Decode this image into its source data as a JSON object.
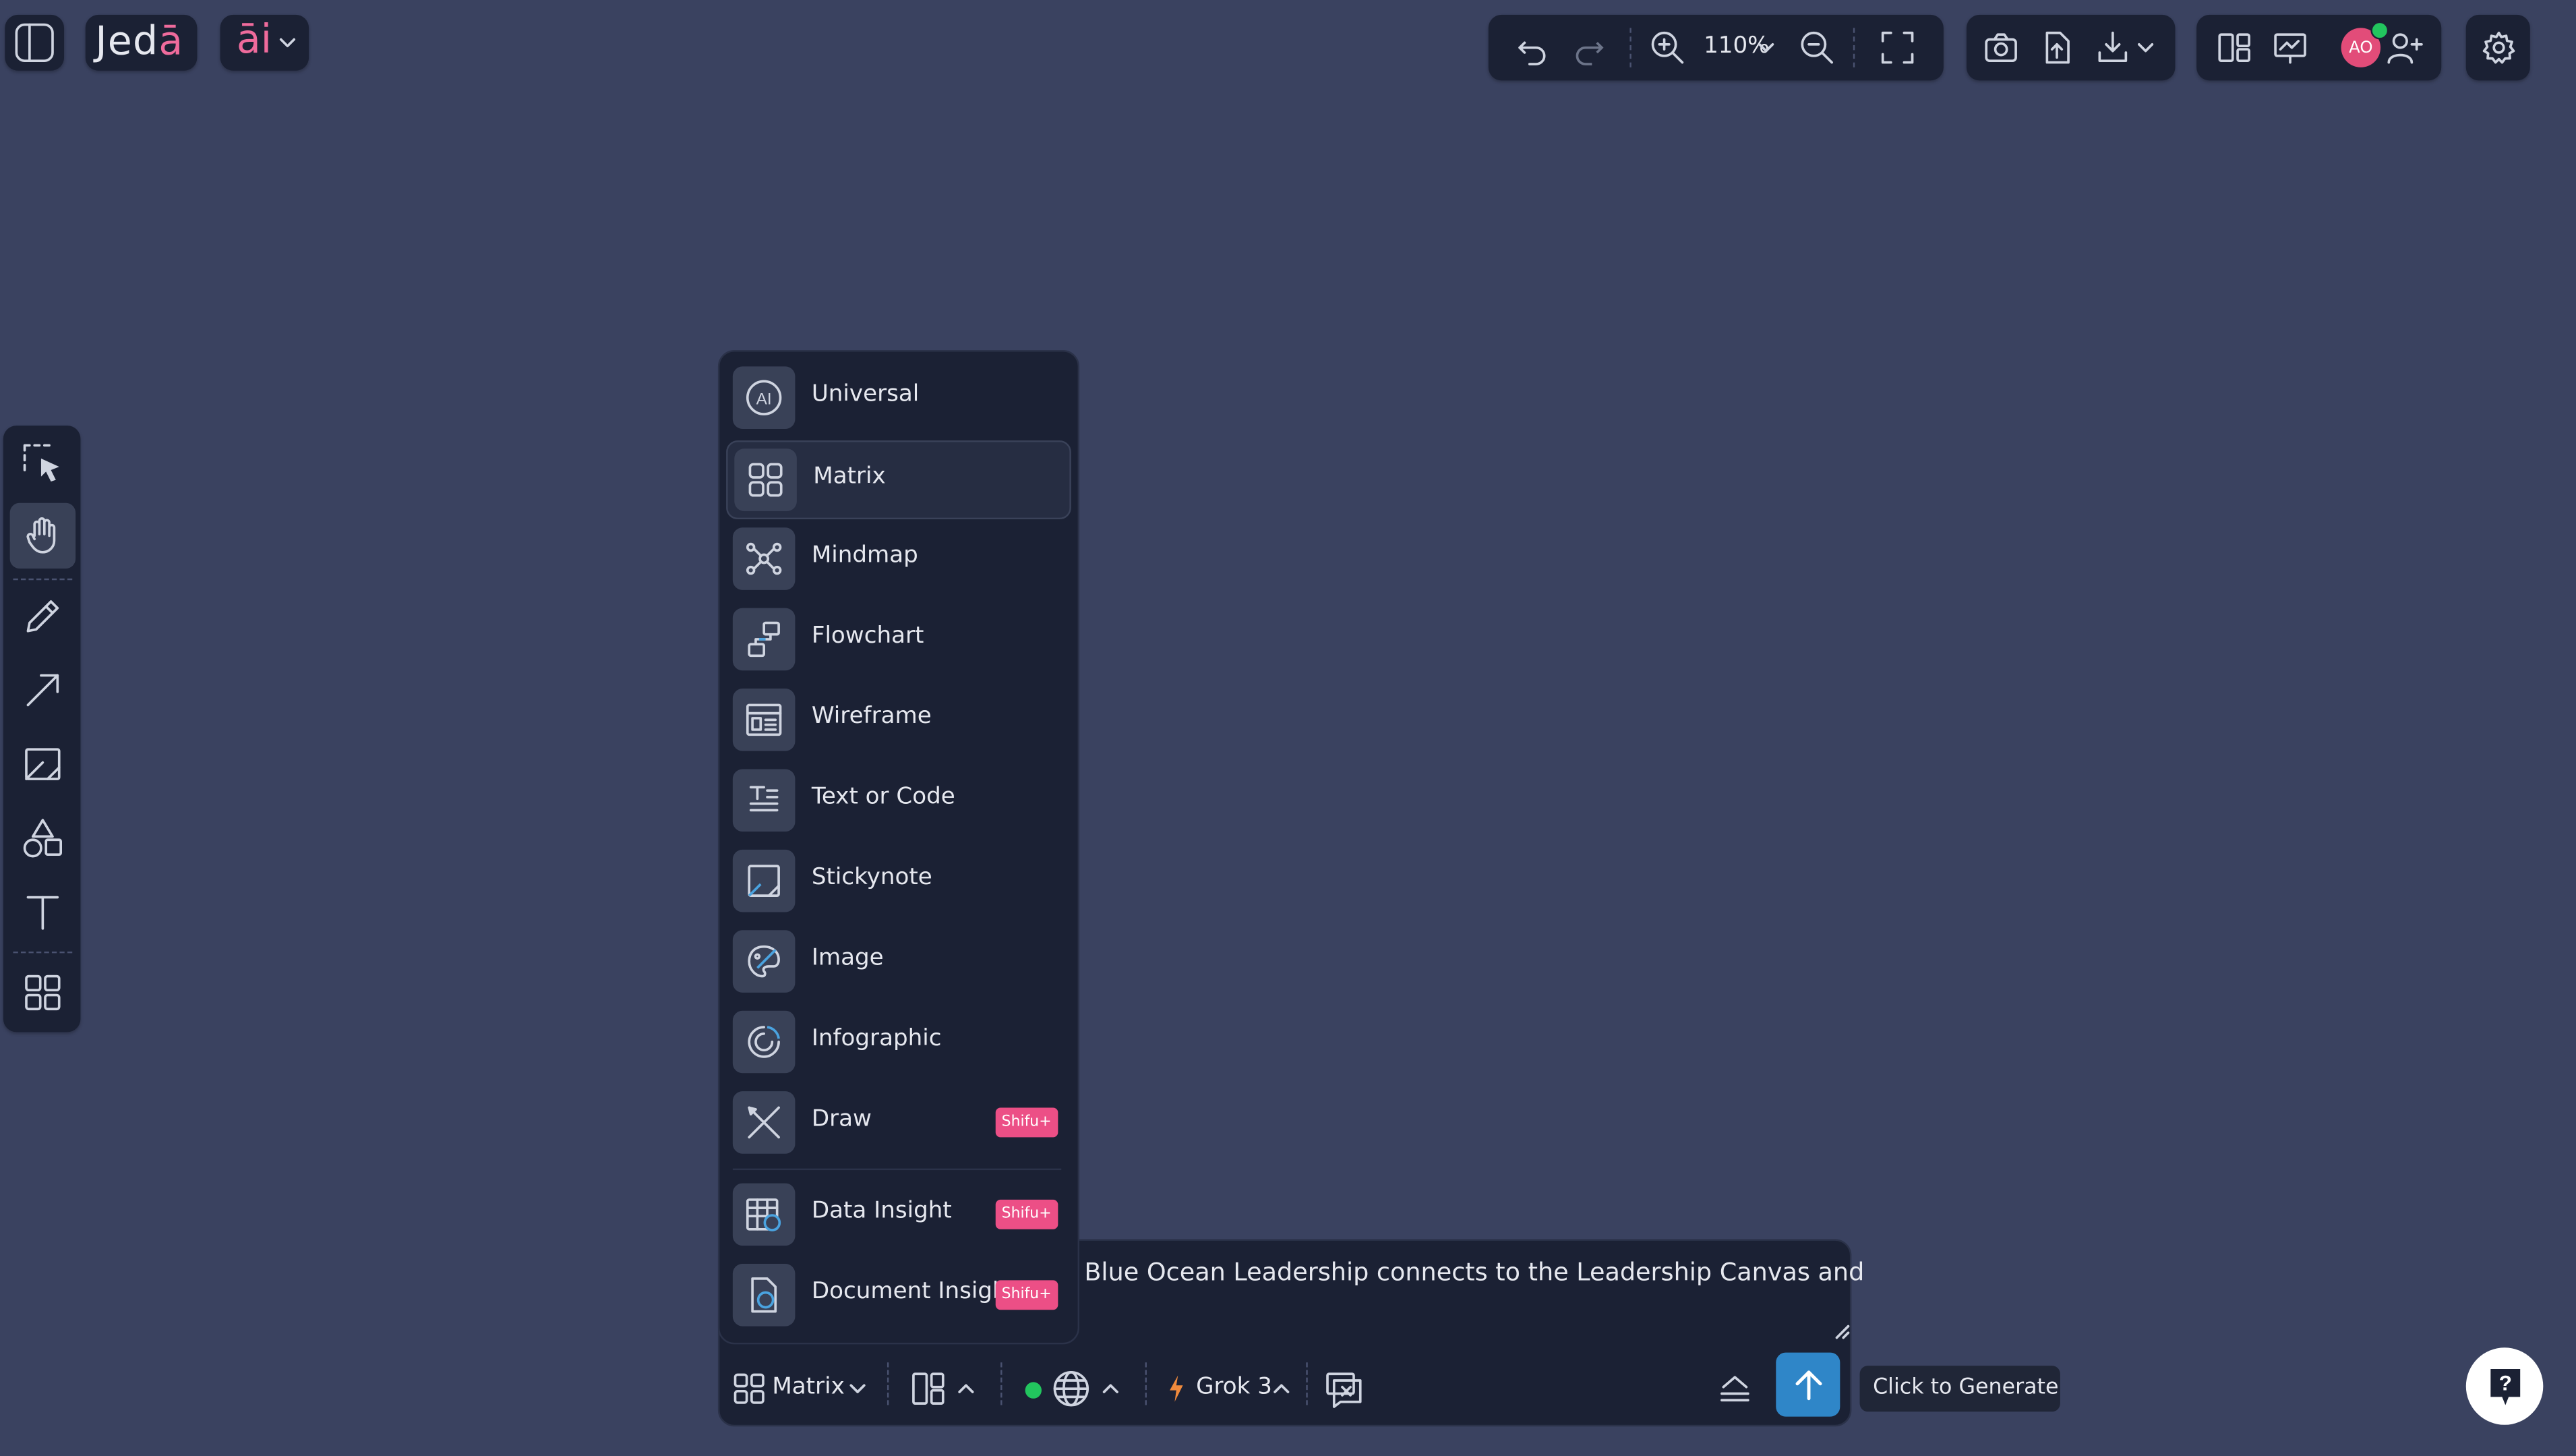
{
  "app": {
    "logo_main": "Jed",
    "logo_accent": "ā",
    "ai_label": "āi"
  },
  "topbar": {
    "zoom": "110%",
    "avatar_initials": "AO"
  },
  "menu": {
    "items": [
      {
        "label": "Universal",
        "icon": "ai-icon"
      },
      {
        "label": "Matrix",
        "icon": "grid-icon",
        "selected": true
      },
      {
        "label": "Mindmap",
        "icon": "mindmap-icon"
      },
      {
        "label": "Flowchart",
        "icon": "flowchart-icon"
      },
      {
        "label": "Wireframe",
        "icon": "wireframe-icon"
      },
      {
        "label": "Text or Code",
        "icon": "text-code-icon"
      },
      {
        "label": "Stickynote",
        "icon": "stickynote-icon"
      },
      {
        "label": "Image",
        "icon": "image-icon"
      },
      {
        "label": "Infographic",
        "icon": "infographic-icon"
      },
      {
        "label": "Draw",
        "icon": "draw-icon",
        "badge": "Shifu+"
      },
      {
        "label": "Data Insight",
        "icon": "data-insight-icon",
        "badge": "Shifu+"
      },
      {
        "label": "Document Insight",
        "icon": "document-insight-icon",
        "badge": "Shifu+"
      }
    ]
  },
  "prompt": {
    "text": "Blue Ocean Leadership connects to the Leadership Canvas and",
    "mode_label": "Matrix",
    "model_label": "Grok 3"
  },
  "tooltip": {
    "generate": "Click to Generate"
  },
  "colors": {
    "canvas": "#3a4260",
    "panel": "#1b2134",
    "accent": "#ef6b9c",
    "send": "#2f86c8"
  }
}
